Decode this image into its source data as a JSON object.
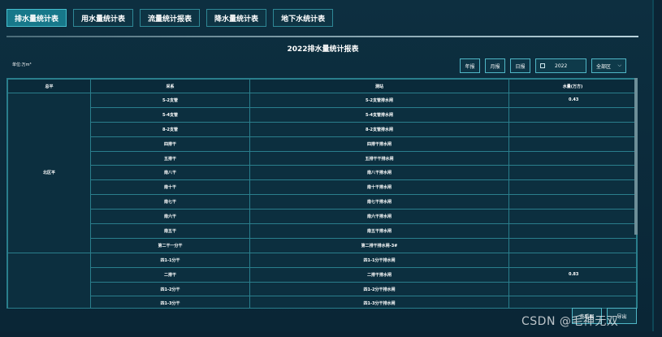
{
  "tabs": [
    {
      "label": "排水量统计表",
      "active": true
    },
    {
      "label": "用水量统计表",
      "active": false
    },
    {
      "label": "流量统计报表",
      "active": false
    },
    {
      "label": "降水量统计表",
      "active": false
    },
    {
      "label": "地下水统计表",
      "active": false
    }
  ],
  "report": {
    "title": "2022排水量统计报表",
    "unit": "单位:万m³"
  },
  "controls": {
    "year_btn": "年报",
    "month_btn": "月报",
    "day_btn": "日报",
    "date_value": "2022",
    "area_select": "全部区"
  },
  "table": {
    "headers": [
      "总平",
      "采系",
      "测站",
      "水量(万方)"
    ],
    "groups": [
      {
        "name": "北区平",
        "rows": [
          [
            "5-2支管",
            "5-2支管排水闸",
            "0.43"
          ],
          [
            "5-4支管",
            "5-4支管排水闸",
            ""
          ],
          [
            "8-2支管",
            "8-2支管排水闸",
            ""
          ],
          [
            "四排干",
            "四排干排水闸",
            ""
          ],
          [
            "五排干",
            "五排干干排水闸",
            ""
          ],
          [
            "南八干",
            "南八干排水闸",
            ""
          ],
          [
            "南十干",
            "南十干排水闸",
            ""
          ],
          [
            "南七干",
            "南七干排水闸",
            ""
          ],
          [
            "南六干",
            "南六干排水闸",
            ""
          ],
          [
            "南五干",
            "南五干排水闸",
            ""
          ],
          [
            "第二干一分干",
            "第二排干排水闸-3#",
            ""
          ]
        ]
      },
      {
        "name": "",
        "rows": [
          [
            "四1-1分干",
            "四1-1分干排水闸",
            ""
          ],
          [
            "二排干",
            "二排干排水闸",
            "0.83"
          ],
          [
            "四1-2分干",
            "四1-2分干排水闸",
            ""
          ],
          [
            "四1-3分干",
            "四1-3分干排水闸",
            ""
          ]
        ]
      }
    ]
  },
  "float_buttons": [
    "查看图",
    "导出"
  ],
  "watermark": "CSDN @毛神无双"
}
